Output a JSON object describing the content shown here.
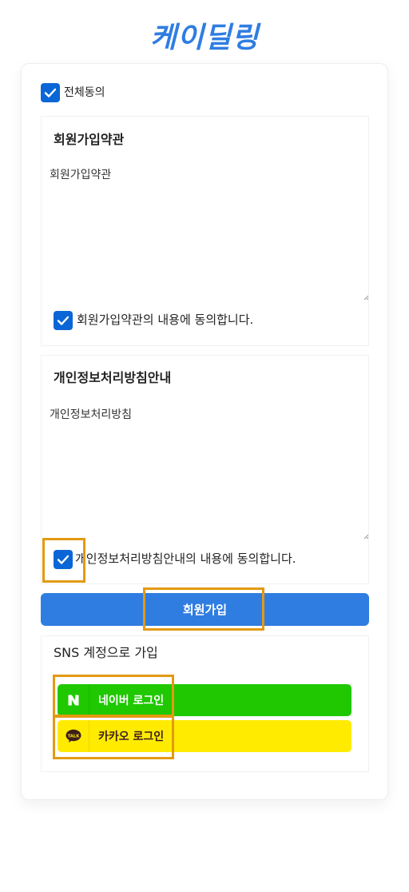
{
  "logo": {
    "text": "케이딜링"
  },
  "all_agree": {
    "label": "전체동의",
    "checked": true
  },
  "terms": {
    "title": "회원가입약관",
    "content": "회원가입약관",
    "agree_label": "회원가입약관의 내용에 동의합니다.",
    "checked": true
  },
  "privacy": {
    "title": "개인정보처리방침안내",
    "content": "개인정보처리방침",
    "agree_label": "개인정보처리방침안내의 내용에 동의합니다.",
    "checked": true
  },
  "signup_button": {
    "label": "회원가입"
  },
  "sns": {
    "title": "SNS 계정으로 가입",
    "naver": {
      "label": "네이버 로그인",
      "icon": "naver-icon",
      "color": "#1fc800"
    },
    "kakao": {
      "label": "카카오 로그인",
      "icon": "kakao-talk-icon",
      "color": "#ffeb00"
    }
  },
  "colors": {
    "accent": "#2f7de1",
    "checkbox": "#0a66d6",
    "highlight": "#e39a12"
  }
}
